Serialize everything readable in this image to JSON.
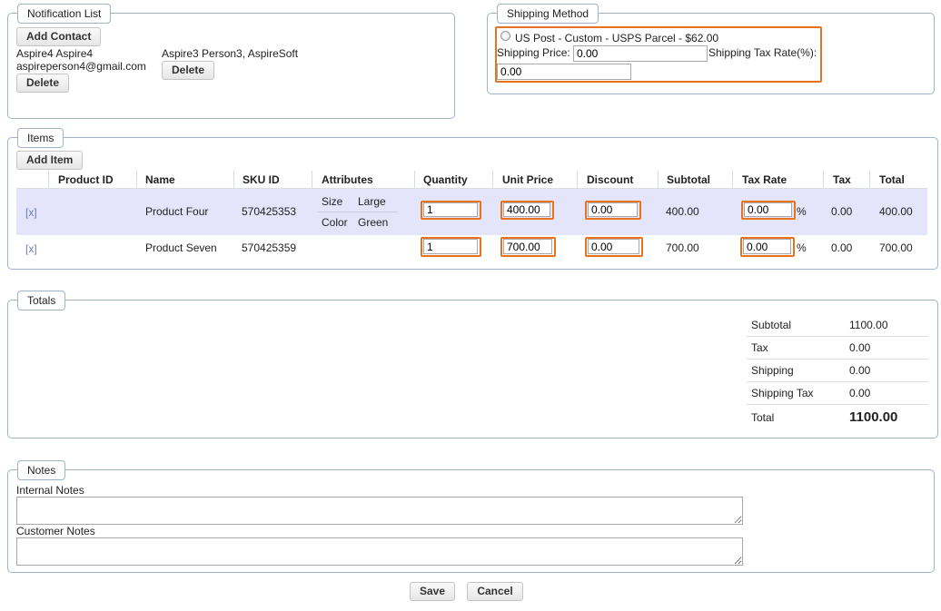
{
  "notification": {
    "legend": "Notification List",
    "add_contact": "Add Contact",
    "contacts": [
      {
        "name": "Aspire4 Aspire4",
        "detail": "aspireperson4@gmail.com",
        "delete": "Delete"
      },
      {
        "name": "Aspire3 Person3, AspireSoft",
        "detail": "",
        "delete": "Delete"
      }
    ]
  },
  "shipping": {
    "legend": "Shipping Method",
    "option_label": "US Post - Custom - USPS Parcel - $62.00",
    "price_label": "Shipping Price:",
    "price_value": "0.00",
    "tax_rate_label": "Shipping Tax Rate(%):",
    "tax_rate_value": "0.00"
  },
  "items": {
    "legend": "Items",
    "add_item": "Add Item",
    "columns": [
      "Product ID",
      "Name",
      "SKU ID",
      "Attributes",
      "Quantity",
      "Unit Price",
      "Discount",
      "Subtotal",
      "Tax Rate",
      "Tax",
      "Total"
    ],
    "rows": [
      {
        "remove": "[x]",
        "name": "Product Four",
        "sku": "570425353",
        "attributes": [
          {
            "key": "Size",
            "value": "Large"
          },
          {
            "key": "Color",
            "value": "Green"
          }
        ],
        "quantity": "1",
        "unit_price": "400.00",
        "discount": "0.00",
        "subtotal": "400.00",
        "tax_rate": "0.00",
        "percent": "%",
        "tax": "0.00",
        "total": "400.00"
      },
      {
        "remove": "[x]",
        "name": "Product Seven",
        "sku": "570425359",
        "attributes": [],
        "quantity": "1",
        "unit_price": "700.00",
        "discount": "0.00",
        "subtotal": "700.00",
        "tax_rate": "0.00",
        "percent": "%",
        "tax": "0.00",
        "total": "700.00"
      }
    ]
  },
  "totals": {
    "legend": "Totals",
    "lines": [
      {
        "label": "Subtotal",
        "value": "1100.00"
      },
      {
        "label": "Tax",
        "value": "0.00"
      },
      {
        "label": "Shipping",
        "value": "0.00"
      },
      {
        "label": "Shipping Tax",
        "value": "0.00"
      },
      {
        "label": "Total",
        "value": "1100.00"
      }
    ]
  },
  "notes": {
    "legend": "Notes",
    "internal_label": "Internal Notes",
    "internal_value": "",
    "customer_label": "Customer Notes",
    "customer_value": ""
  },
  "actions": {
    "save": "Save",
    "cancel": "Cancel"
  },
  "colors": {
    "highlight": "#e8731e",
    "row_selected": "#e4e4fa",
    "border": "#9fb3c6"
  }
}
